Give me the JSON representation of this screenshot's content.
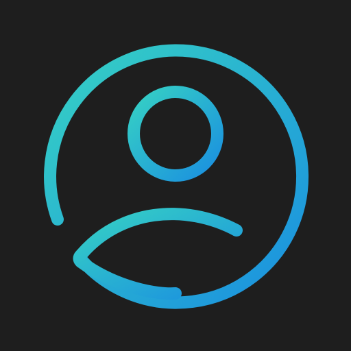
{
  "icon": {
    "name": "user-profile-icon",
    "colors": {
      "background": "#1e1e1e",
      "gradient_start": "#36d1c4",
      "gradient_end": "#1a8fe0"
    }
  }
}
